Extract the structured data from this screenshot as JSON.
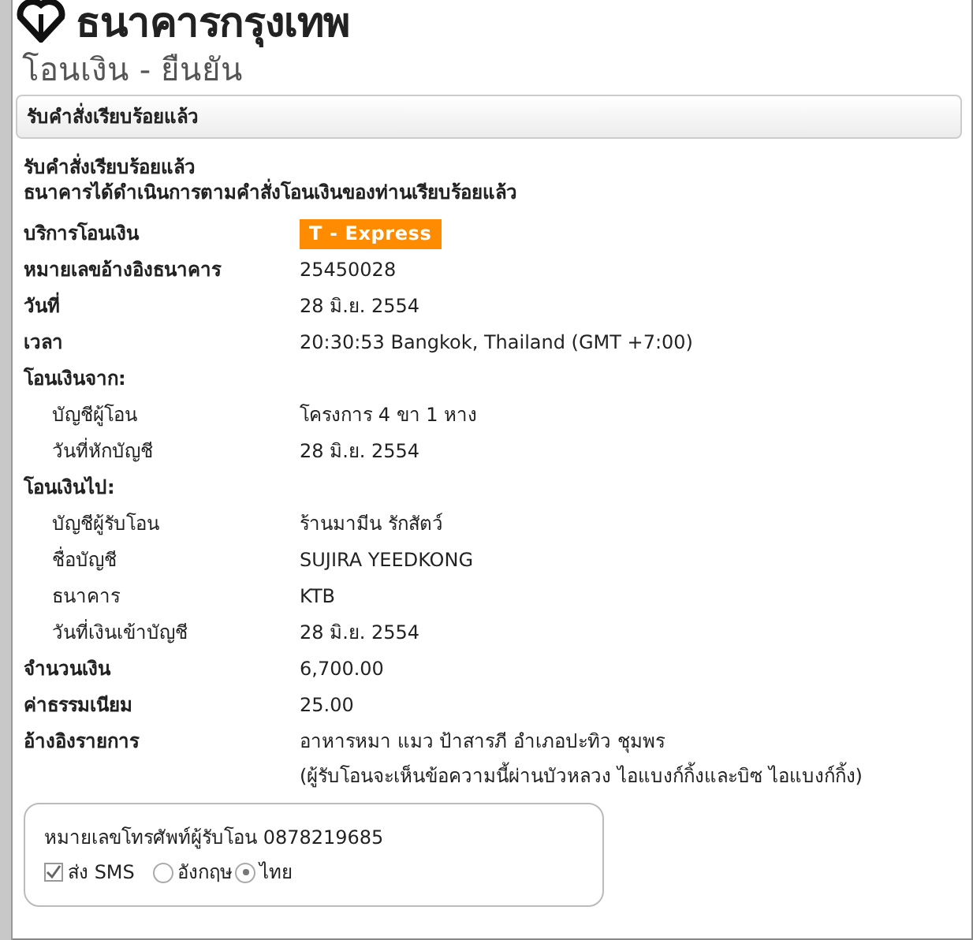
{
  "logo": {
    "text": "ธนาคารกรุงเทพ"
  },
  "page_title": "โอนเงิน - ยืนยัน",
  "header_bar": "รับคำสั่งเรียบร้อยแล้ว",
  "message": {
    "title": "รับคำสั่งเรียบร้อยแล้ว",
    "body": "ธนาคารได้ดำเนินการตามคำสั่งโอนเงินของท่านเรียบร้อยแล้ว"
  },
  "rows": [
    {
      "kind": "badge",
      "label": "บริการโอนเงิน",
      "value": "T - Express"
    },
    {
      "kind": "main",
      "label": "หมายเลขอ้างอิงธนาคาร",
      "value": "25450028"
    },
    {
      "kind": "main",
      "label": "วันที่",
      "value": "28 มิ.ย. 2554"
    },
    {
      "kind": "main",
      "label": "เวลา",
      "value": "20:30:53 Bangkok, Thailand (GMT +7:00)"
    },
    {
      "kind": "section",
      "label": "โอนเงินจาก:"
    },
    {
      "kind": "sub",
      "label": "บัญชีผู้โอน",
      "value": "โครงการ 4 ขา 1 หาง"
    },
    {
      "kind": "sub",
      "label": "วันที่หักบัญชี",
      "value": "28 มิ.ย. 2554"
    },
    {
      "kind": "section",
      "label": "โอนเงินไป:"
    },
    {
      "kind": "sub",
      "label": "บัญชีผู้รับโอน",
      "value": "ร้านมามีน รักสัตว์"
    },
    {
      "kind": "sub",
      "label": "ชื่อบัญชี",
      "value": "SUJIRA YEEDKONG"
    },
    {
      "kind": "sub",
      "label": "ธนาคาร",
      "value": "KTB"
    },
    {
      "kind": "sub",
      "label": "วันที่เงินเข้าบัญชี",
      "value": "28 มิ.ย. 2554"
    },
    {
      "kind": "main",
      "label": "จำนวนเงิน",
      "value": "6,700.00"
    },
    {
      "kind": "main",
      "label": "ค่าธรรมเนียม",
      "value": "25.00"
    },
    {
      "kind": "main",
      "label": "อ้างอิงรายการ",
      "value": "อาหารหมา แมว ป้าสารภี อำเภอปะทิว ชุมพร",
      "note": "(ผู้รับโอนจะเห็นข้อความนี้ผ่านบัวหลวง ไอแบงก์กิ้งและบิซ ไอแบงก์กิ้ง)"
    }
  ],
  "sms": {
    "phone_text": "หมายเลขโทรศัพท์ผู้รับโอน 0878219685",
    "checkbox": {
      "label": "ส่ง SMS",
      "checked": true
    },
    "languages": [
      {
        "label": "อังกฤษ",
        "selected": false
      },
      {
        "label": "ไทย",
        "selected": true
      }
    ]
  }
}
